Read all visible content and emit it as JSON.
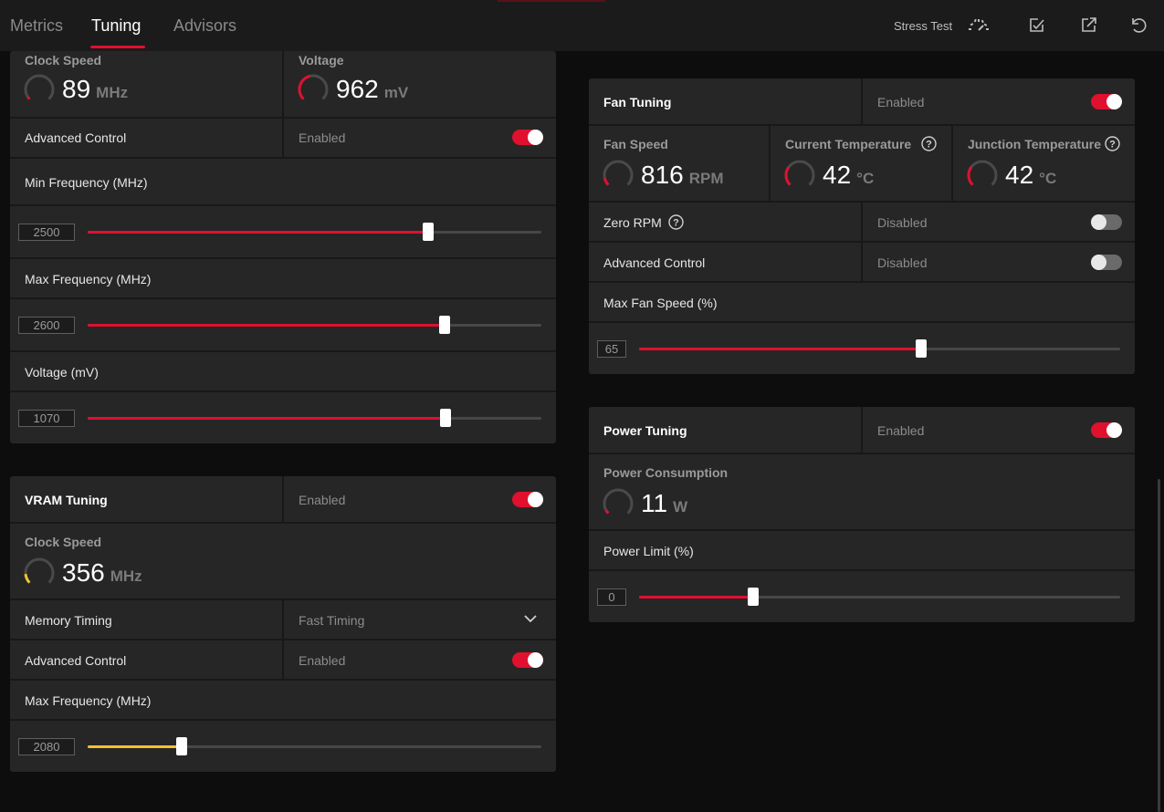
{
  "nav": {
    "tabs": [
      "Metrics",
      "Tuning",
      "Advisors"
    ],
    "active_tab": "Tuning",
    "stress_test_label": "Stress Test"
  },
  "gpu_tuning": {
    "clock_speed": {
      "label": "Clock Speed",
      "value": "89",
      "unit": "MHz",
      "gauge_fraction": 0.04
    },
    "voltage": {
      "label": "Voltage",
      "value": "962",
      "unit": "mV",
      "gauge_fraction": 0.45
    },
    "advanced_control": {
      "label": "Advanced Control",
      "status": "Enabled",
      "on": true
    },
    "min_frequency": {
      "label": "Min Frequency (MHz)",
      "value": "2500",
      "fraction": 0.75
    },
    "max_frequency": {
      "label": "Max Frequency (MHz)",
      "value": "2600",
      "fraction": 0.786
    },
    "voltage_slider": {
      "label": "Voltage (mV)",
      "value": "1070",
      "fraction": 0.788
    }
  },
  "vram_tuning": {
    "title": "VRAM Tuning",
    "status": "Enabled",
    "on": true,
    "clock_speed": {
      "label": "Clock Speed",
      "value": "356",
      "unit": "MHz",
      "gauge_fraction": 0.15
    },
    "memory_timing": {
      "label": "Memory Timing",
      "value": "Fast Timing"
    },
    "advanced_control": {
      "label": "Advanced Control",
      "status": "Enabled",
      "on": true
    },
    "max_frequency": {
      "label": "Max Frequency (MHz)",
      "value": "2080",
      "fraction": 0.208
    }
  },
  "fan_tuning": {
    "title": "Fan Tuning",
    "status": "Enabled",
    "on": true,
    "fan_speed": {
      "label": "Fan Speed",
      "value": "816",
      "unit": "RPM",
      "gauge_fraction": 0.12
    },
    "current_temperature": {
      "label": "Current Temperature",
      "value": "42",
      "unit": "°C",
      "gauge_fraction": 0.3
    },
    "junction_temperature": {
      "label": "Junction Temperature",
      "value": "42",
      "unit": "°C",
      "gauge_fraction": 0.3
    },
    "zero_rpm": {
      "label": "Zero RPM",
      "status": "Disabled",
      "on": false
    },
    "advanced_control": {
      "label": "Advanced Control",
      "status": "Disabled",
      "on": false
    },
    "max_fan_speed": {
      "label": "Max Fan Speed (%)",
      "value": "65",
      "fraction": 0.586
    }
  },
  "power_tuning": {
    "title": "Power Tuning",
    "status": "Enabled",
    "on": true,
    "power_consumption": {
      "label": "Power Consumption",
      "value": "11",
      "unit": "W",
      "gauge_fraction": 0.06
    },
    "power_limit": {
      "label": "Power Limit (%)",
      "value": "0",
      "fraction": 0.238
    }
  },
  "colors": {
    "accent_red": "#e0102f",
    "accent_yellow": "#f2c230",
    "panel": "#262626",
    "background": "#0d0d0d"
  },
  "icons": [
    "stress-test-gauge-icon",
    "apply-icon",
    "export-icon",
    "reset-icon",
    "chevron-down-icon",
    "help-icon"
  ]
}
